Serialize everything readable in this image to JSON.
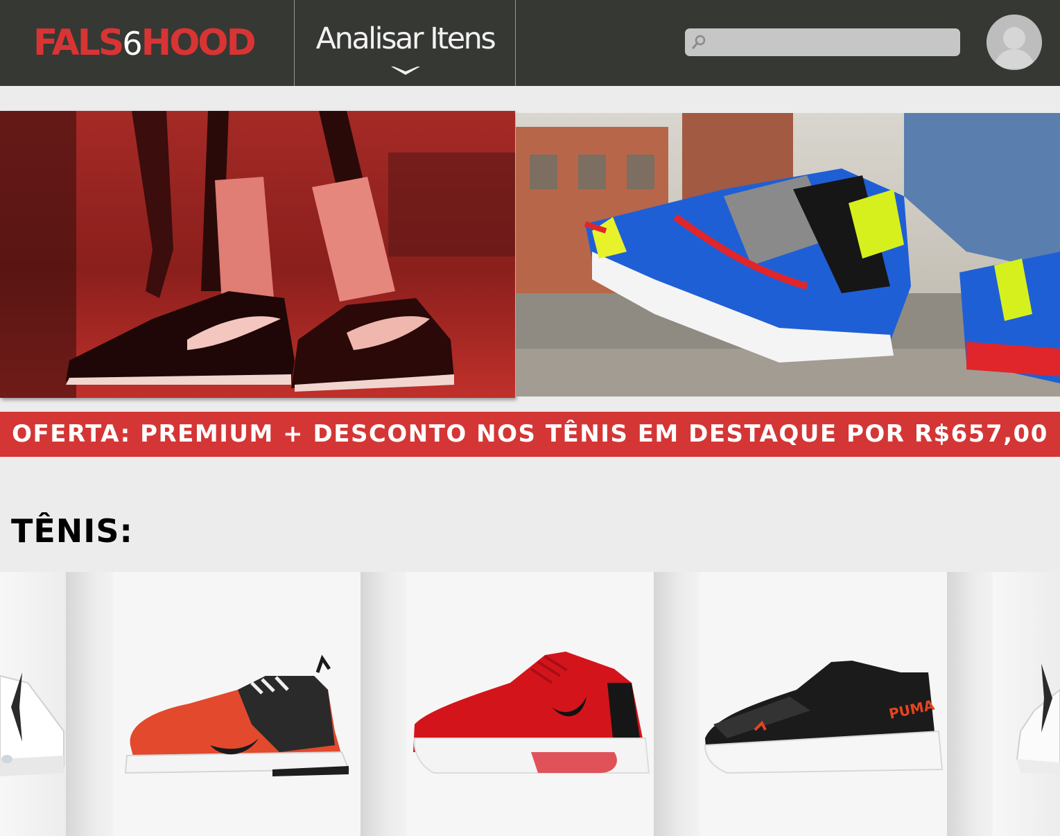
{
  "header": {
    "logo": {
      "part1": "FALS",
      "part2": "6",
      "part3": "HOOD"
    },
    "nav": {
      "label": "Analisar Itens",
      "chevron_icon": "chevron-down-icon"
    },
    "search": {
      "value": "",
      "placeholder": "",
      "icon": "search-icon"
    },
    "avatar": {
      "icon": "user-avatar-icon"
    }
  },
  "hero": {
    "left_image": "sneaker-photo-red-tint",
    "right_image": "sneaker-photo-street"
  },
  "offer_banner": {
    "text": "OFERTA: PREMIUM + DESCONTO NOS TÊNIS EM DESTAQUE POR R$657,00"
  },
  "section": {
    "title": "TÊNIS:"
  },
  "carousel": {
    "prev_icon": "chevron-left-icon",
    "next_icon": "chevron-right-icon",
    "products": [
      {
        "image": "sneaker-orange-black"
      },
      {
        "image": "sneaker-red-puma"
      },
      {
        "image": "sneaker-black-puma"
      }
    ]
  },
  "colors": {
    "header_bg": "#363834",
    "brand_red": "#d93434",
    "banner_red": "#d43636",
    "page_bg": "#ececec"
  }
}
